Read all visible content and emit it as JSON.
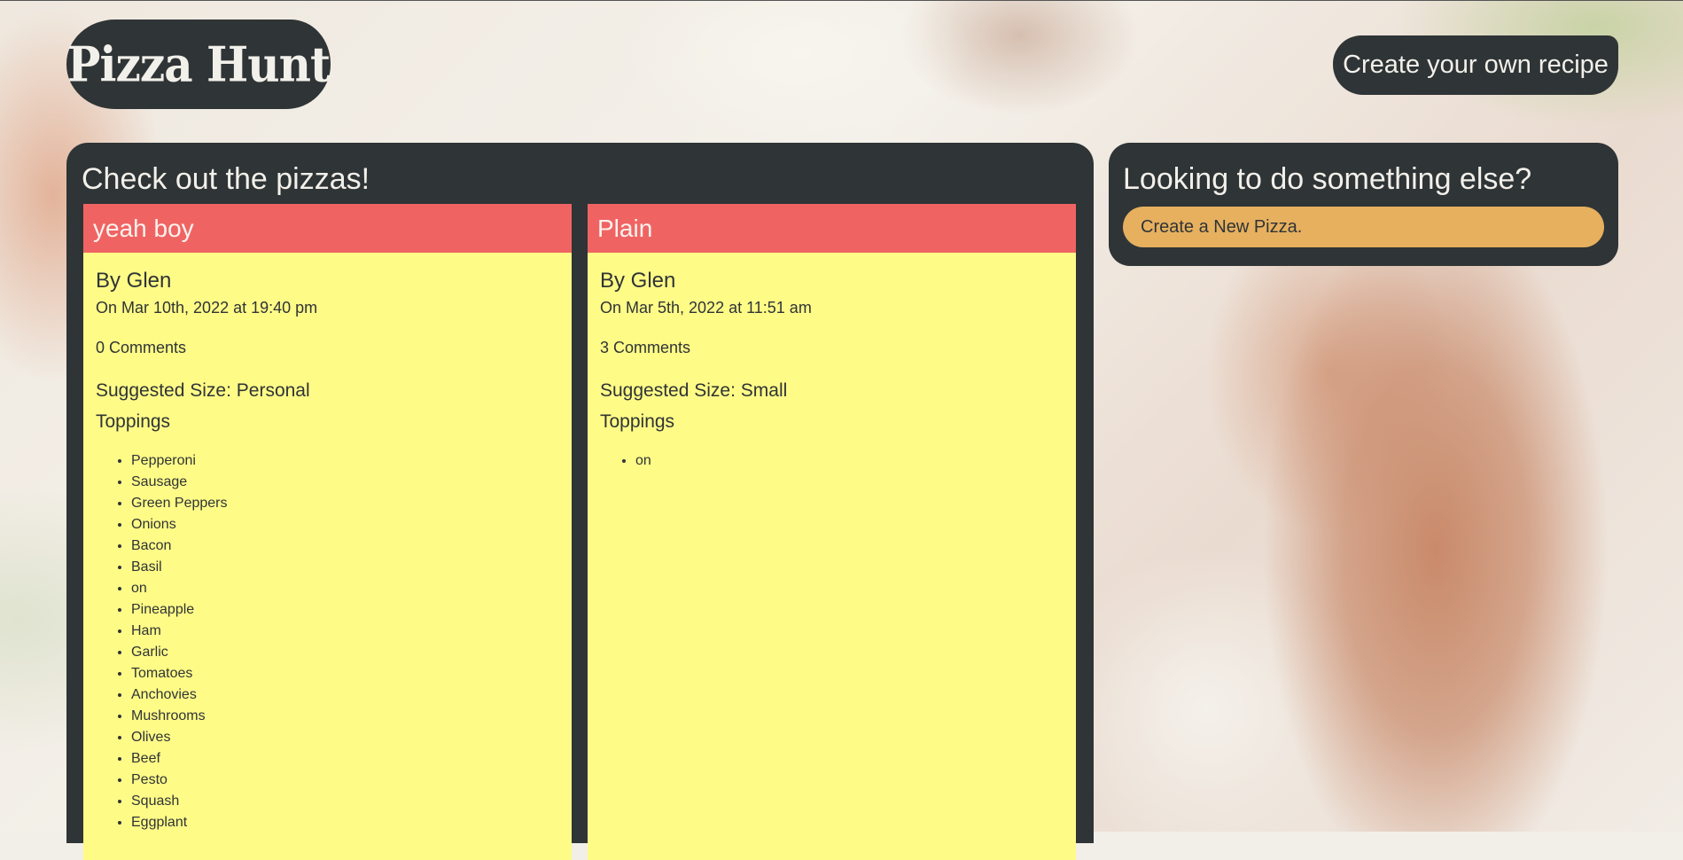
{
  "header": {
    "logo_text": "Pizza Hunt",
    "create_recipe_label": "Create your own recipe"
  },
  "main": {
    "title": "Check out the pizzas!",
    "pizzas": [
      {
        "name": "yeah boy",
        "by": "By Glen",
        "date": "On Mar 10th, 2022 at 19:40 pm",
        "comments": "0 Comments",
        "size": "Suggested Size: Personal",
        "toppings_label": "Toppings",
        "toppings": [
          "Pepperoni",
          "Sausage",
          "Green Peppers",
          "Onions",
          "Bacon",
          "Basil",
          "on",
          "Pineapple",
          "Ham",
          "Garlic",
          "Tomatoes",
          "Anchovies",
          "Mushrooms",
          "Olives",
          "Beef",
          "Pesto",
          "Squash",
          "Eggplant"
        ]
      },
      {
        "name": "Plain",
        "by": "By Glen",
        "date": "On Mar 5th, 2022 at 11:51 am",
        "comments": "3 Comments",
        "size": "Suggested Size: Small",
        "toppings_label": "Toppings",
        "toppings": [
          "on"
        ]
      }
    ]
  },
  "sidebar": {
    "title": "Looking to do something else?",
    "new_pizza_label": "Create a New Pizza."
  },
  "colors": {
    "panel": "#2f3436",
    "card_header": "#ef6463",
    "card_body": "#fffb87",
    "button": "#e6b05f",
    "light_text": "#f2f0ea"
  }
}
